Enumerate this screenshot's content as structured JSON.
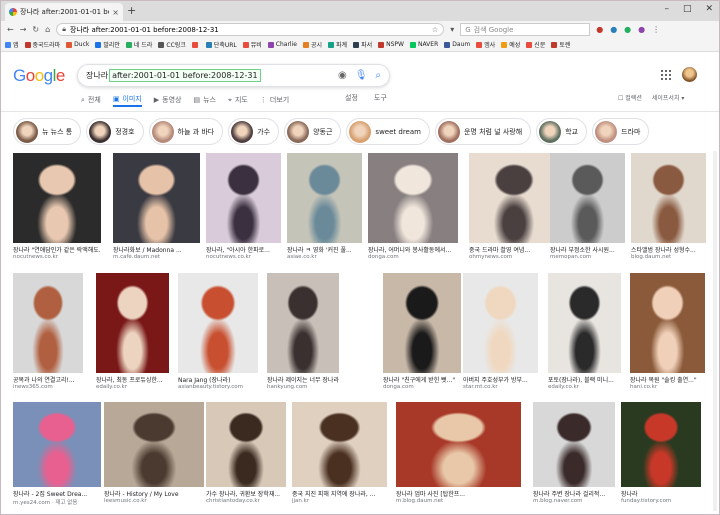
{
  "browser": {
    "tab_title": "장나라 after:2001-01-01 before",
    "tab_close": "×",
    "newtab": "+",
    "controls": [
      "–",
      "□",
      "✕"
    ],
    "url_prefix": "google.com/search?q=",
    "url": "장나라 after:2001-01-01 before:2008-12-31",
    "search_placeholder": "검색 Google",
    "bookmarks": [
      {
        "label": "앱",
        "color": "#4285f4"
      },
      {
        "label": "중국드라마",
        "color": "#c0392b"
      },
      {
        "label": "Duck",
        "color": "#de5833"
      },
      {
        "label": "발리안",
        "color": "#1a73e8"
      },
      {
        "label": "네 드라",
        "color": "#27ae60"
      },
      {
        "label": "CC링크",
        "color": "#555555"
      },
      {
        "label": "",
        "color": "#e74c3c"
      },
      {
        "label": "단축URL",
        "color": "#2980b9"
      },
      {
        "label": "뮤비",
        "color": "#e74c3c"
      },
      {
        "label": "Charlie",
        "color": "#8e44ad"
      },
      {
        "label": "공시",
        "color": "#e67e22"
      },
      {
        "label": "파계",
        "color": "#16a085"
      },
      {
        "label": "파서",
        "color": "#2c3e50"
      },
      {
        "label": "NSPW",
        "color": "#c0392b"
      },
      {
        "label": "NAVER",
        "color": "#03c75a"
      },
      {
        "label": "Daum",
        "color": "#3b5998"
      },
      {
        "label": "엠사",
        "color": "#e74c3c"
      },
      {
        "label": "예성",
        "color": "#f39c12"
      },
      {
        "label": "신문",
        "color": "#e74c3c"
      },
      {
        "label": "토렌",
        "color": "#c0392b"
      }
    ]
  },
  "google": {
    "logo": [
      "G",
      "o",
      "o",
      "g",
      "l",
      "e"
    ],
    "query_main": "장나라",
    "query_operators": "after:2001-01-01 before:2008-12-31",
    "tabs": [
      {
        "icon": "⌕",
        "label": "전체"
      },
      {
        "icon": "▣",
        "label": "이미지",
        "active": true
      },
      {
        "icon": "▶",
        "label": "동영상"
      },
      {
        "icon": "▤",
        "label": "뉴스"
      },
      {
        "icon": "⌖",
        "label": "지도"
      },
      {
        "icon": "⋮",
        "label": "더보기"
      }
    ],
    "tools": [
      "설정",
      "도구"
    ],
    "right": [
      "컬렉션",
      "세이프서치 ▾"
    ]
  },
  "chips": [
    {
      "label": "뉴 뉴스 통",
      "color": "#7a5c48"
    },
    {
      "label": "정경호",
      "color": "#3c3030"
    },
    {
      "label": "하늘 과 바다",
      "color": "#b58a7a"
    },
    {
      "label": "가수",
      "color": "#504040"
    },
    {
      "label": "양동근",
      "color": "#8a6a5a"
    },
    {
      "label": "sweet dream",
      "color": "#d8a070"
    },
    {
      "label": "운명 처럼 널 사랑해",
      "color": "#a07060"
    },
    {
      "label": "학교",
      "color": "#607060"
    },
    {
      "label": "드라마",
      "color": "#c09080"
    }
  ],
  "rows": [
    [
      {
        "caption": "장나라 \"연애담인가 같은 락액해도...",
        "source": "nocutnews.co.kr",
        "color": "#2b2b2b",
        "accent": "#e8c8b0"
      },
      {
        "caption": "장나라화보 / Madonna ...",
        "source": "m.cafe.daum.net",
        "color": "#3a3a42",
        "accent": "#e6c2a8"
      },
      {
        "caption": "장나라, \"아시아 한파로...",
        "source": "nocutnews.co.kr",
        "color": "#d9cbd9",
        "accent": "#3a3040"
      },
      {
        "caption": "장나라 ㅋ 영화 '커진 풀...",
        "source": "asiae.co.kr",
        "color": "#c4c4b8",
        "accent": "#6a8a9a"
      },
      {
        "caption": "장나라, 어머니와 봉사활동에서...",
        "source": "donga.com",
        "color": "#888080",
        "accent": "#f0e6dc"
      },
      {
        "caption": "중국 드라마 촬영 여념...",
        "source": "ohmynews.com",
        "color": "#e8dcd0",
        "accent": "#4a4040"
      },
      {
        "caption": "장나라 부정소한 사시원...",
        "source": "memopan.com",
        "color": "#cccccc",
        "accent": "#5a5a5a"
      },
      {
        "caption": "스타앨범 장나라 성형수...",
        "source": "blog.daum.net",
        "color": "#e0d8cc",
        "accent": "#8a5a40"
      }
    ],
    [
      {
        "caption": "공복과 나의 연결고리!...",
        "source": "inews365.com",
        "color": "#d8d8d8",
        "accent": "#b06040"
      },
      {
        "caption": "장나라, 최동 프로듀싱한...",
        "source": "edaily.co.kr",
        "color": "#7a1818",
        "accent": "#ecd4c0"
      },
      {
        "caption": "Nara Jang (장나라)",
        "source": "asianbeauty.tistory.com",
        "color": "#e8e8e8",
        "accent": "#c85030"
      },
      {
        "caption": "장나라 제이지는 너무 장나라 | 한경...",
        "source": "hankyung.com",
        "color": "#c8c0b8",
        "accent": "#3a3030"
      },
      {
        "caption": "장나라 \"친구에게 받힌 뻣...\"",
        "source": "donga.com",
        "color": "#c8b8a8",
        "accent": "#1a1a1a"
      },
      {
        "caption": "아버지 주호성부가 방부...",
        "source": "star.mt.co.kr",
        "color": "#e8e8e8",
        "accent": "#f0d8c0"
      },
      {
        "caption": "포토(장나라), 블랙 미니...",
        "source": "edaily.co.kr",
        "color": "#e8e4e0",
        "accent": "#2a2a2a"
      },
      {
        "caption": "장나라 복원 \"솔킹 출연...\"",
        "source": "hani.co.kr",
        "color": "#8a5a3a",
        "accent": "#f0d0b8"
      }
    ],
    [
      {
        "caption": "장나라 - 2집 Sweet Drea...",
        "source": "m.yes24.com · 재고 없음",
        "color": "#7a90b8",
        "accent": "#e86090"
      },
      {
        "caption": "장나라 - History / My Love",
        "source": "leesmusic.co.kr",
        "color": "#b8a898",
        "accent": "#4a3a30"
      },
      {
        "caption": "가수 장나라, 귀환보 장학재...",
        "source": "christiantoday.co.kr",
        "color": "#d8c8b8",
        "accent": "#3a2a20"
      },
      {
        "caption": "중국 지진 피해 지역에 장나라, ...",
        "source": "jjan.kr",
        "color": "#e0d0c0",
        "accent": "#4a3020"
      },
      {
        "caption": "장나라 엄마 사진 [탑한프...",
        "source": "m.blog.daum.net",
        "color": "#a83828",
        "accent": "#e8c8a8"
      },
      {
        "caption": "장나라 주변 장나라 걸리적...",
        "source": "m.blog.naver.com",
        "color": "#d8d8d8",
        "accent": "#3a2a2a"
      },
      {
        "caption": "장나라",
        "source": "funday.tistory.com",
        "color": "#2a3a20",
        "accent": "#c83828"
      }
    ]
  ]
}
